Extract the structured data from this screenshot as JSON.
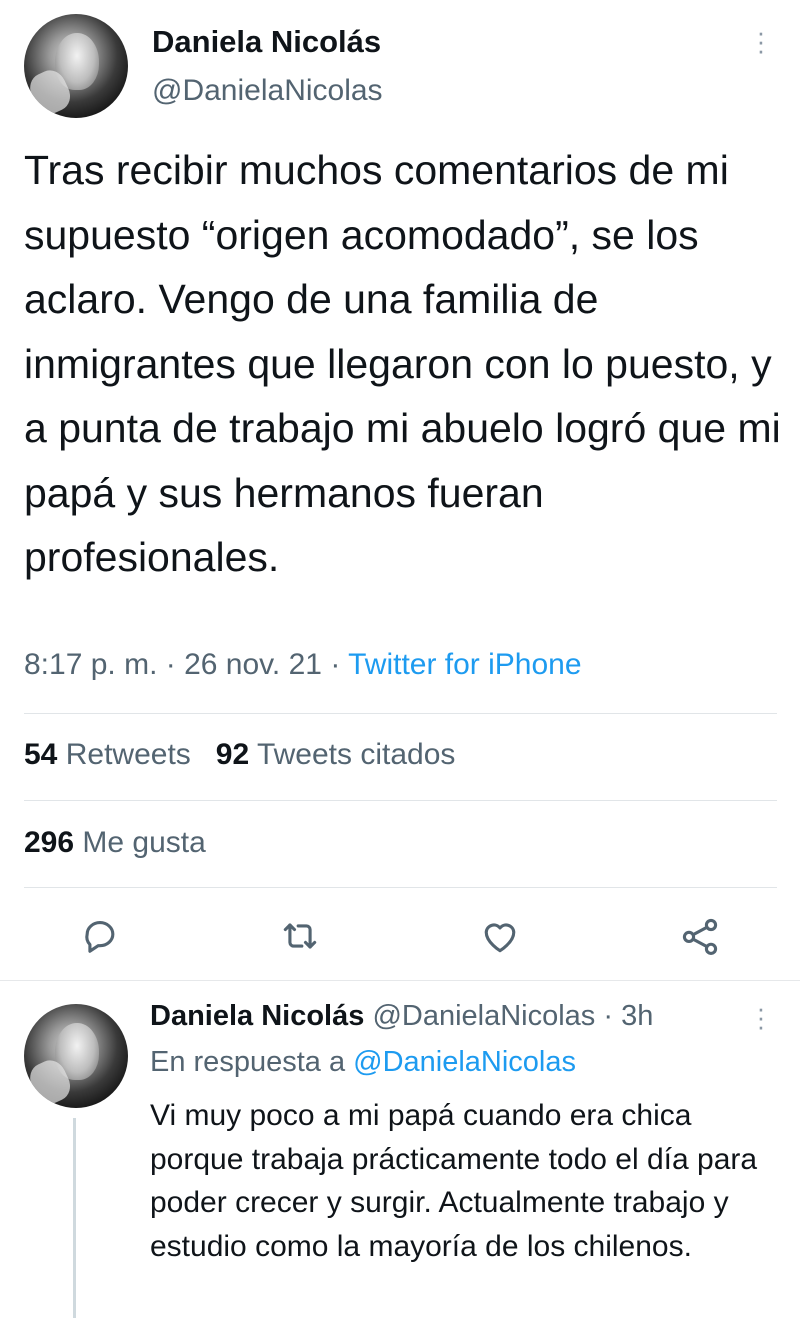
{
  "tweet": {
    "author_name": "Daniela Nicolás",
    "author_handle": "@DanielaNicolas",
    "text": "Tras recibir muchos comentarios de mi supuesto “origen acomodado”, se los aclaro. Vengo de una familia de inmigrantes que llegaron con lo puesto, y a punta de trabajo mi abuelo logró que mi papá y sus hermanos fueran profesionales.",
    "time": "8:17 p. m.",
    "date": "26 nov. 21",
    "source": "Twitter for iPhone",
    "retweets_count": "54",
    "retweets_label": "Retweets",
    "quotes_count": "92",
    "quotes_label": "Tweets citados",
    "likes_count": "296",
    "likes_label": "Me gusta"
  },
  "actions": [
    "reply-icon",
    "retweet-icon",
    "like-icon",
    "share-icon"
  ],
  "reply": {
    "author_name": "Daniela Nicolás",
    "author_handle": "@DanielaNicolas",
    "age": "3h",
    "in_reply_label": "En respuesta a",
    "in_reply_handle": "@DanielaNicolas",
    "text": "Vi muy poco a mi papá cuando era chica porque trabaja prácticamente todo el día para poder crecer y surgir. Actualmente trabajo y estudio como la mayoría de los chilenos."
  },
  "colors": {
    "link": "#1d9bf0",
    "secondary_text": "#536471",
    "primary_text": "#0f1419"
  }
}
